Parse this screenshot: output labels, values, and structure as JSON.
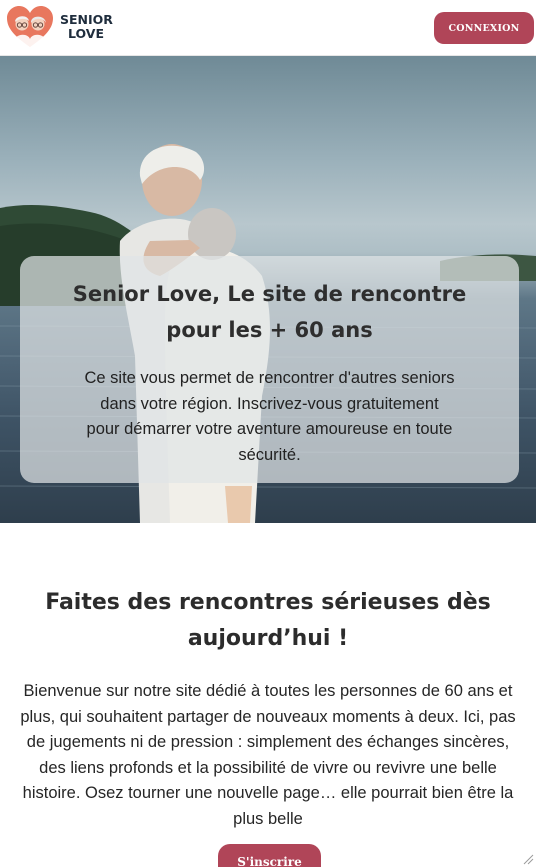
{
  "header": {
    "logo_line1": "SENIOR",
    "logo_line2": "LOVE",
    "login_label": "CONNEXION"
  },
  "hero": {
    "title": "Senior Love, Le site de rencontre pour les + 60 ans",
    "text": "Ce site vous permet de rencontrer d'autres seniors dans votre région. Inscrivez-vous gratuitement pour démarrer votre aventure amoureuse en toute sécurité."
  },
  "intro": {
    "title": "Faites des rencontres sérieuses dès aujourd’hui !",
    "text": "Bienvenue sur notre site dédié à toutes les personnes de 60 ans et plus, qui souhaitent partager de nouveaux moments à deux. Ici, pas de jugements ni de pression : simplement des échanges sincères, des liens profonds et la possibilité de vivre ou revivre une belle histoire. Osez tourner une nouvelle page… elle pourrait bien être la plus belle",
    "cta_label": "S'inscrire"
  },
  "colors": {
    "accent": "#b04558",
    "logo_heart": "#e8775e"
  },
  "icons": {
    "logo": "senior-couple-heart-icon",
    "resize": "resize-grip-icon"
  }
}
